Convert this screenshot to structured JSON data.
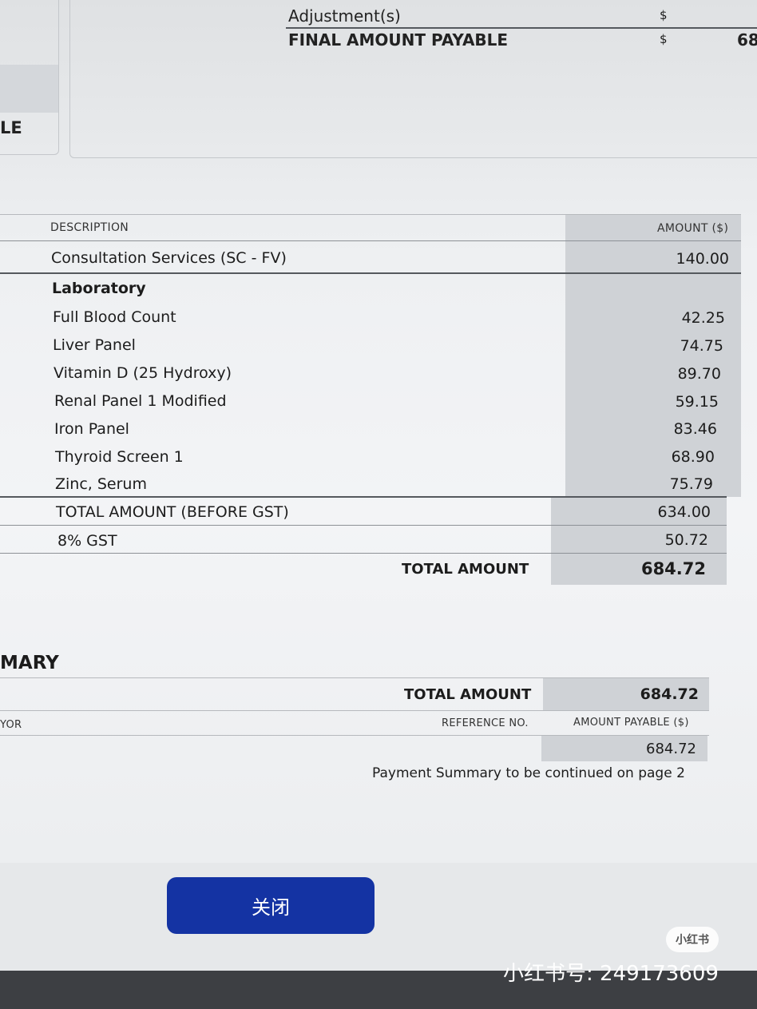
{
  "top_summary": {
    "adjustment_label": "Adjustment(s)",
    "adjustment_currency": "$",
    "final_label": "FINAL AMOUNT PAYABLE",
    "final_currency": "$",
    "final_value_partial": "68"
  },
  "left_box_partial_text": "LE",
  "items_table": {
    "header_description": "DESCRIPTION",
    "header_amount": "AMOUNT ($)",
    "consultation": {
      "label": "Consultation Services (SC - FV)",
      "amount": "140.00"
    },
    "lab_heading": "Laboratory",
    "lab_items": [
      {
        "label": "Full Blood Count",
        "amount": "42.25"
      },
      {
        "label": "Liver Panel",
        "amount": "74.75"
      },
      {
        "label": "Vitamin D (25 Hydroxy)",
        "amount": "89.70"
      },
      {
        "label": "Renal Panel 1 Modified",
        "amount": "59.15"
      },
      {
        "label": "Iron Panel",
        "amount": "83.46"
      },
      {
        "label": "Thyroid Screen 1",
        "amount": "68.90"
      },
      {
        "label": "Zinc, Serum",
        "amount": "75.79"
      }
    ],
    "subtotal": {
      "label": "TOTAL AMOUNT (BEFORE GST)",
      "amount": "634.00"
    },
    "gst": {
      "label": "8% GST",
      "amount": "50.72"
    },
    "total": {
      "label": "TOTAL AMOUNT",
      "amount": "684.72"
    }
  },
  "payment_summary": {
    "title_partial": "MARY",
    "total_label": "TOTAL AMOUNT",
    "total_value": "684.72",
    "payor_partial": "YOR",
    "reference_header": "REFERENCE NO.",
    "amount_payable_header": "AMOUNT PAYABLE ($)",
    "amount_payable_value": "684.72",
    "continued_note": "Payment Summary to be continued on page 2"
  },
  "close_button_label": "关闭",
  "watermark": {
    "badge": "小红书",
    "text": "小红书号: 249173609"
  }
}
